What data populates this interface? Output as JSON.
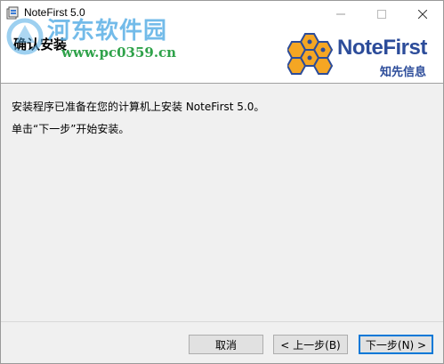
{
  "window": {
    "title": "NoteFirst 5.0",
    "minimize_glyph": "—",
    "maximize_glyph": "☐",
    "close_glyph": "✕"
  },
  "header": {
    "title": "确认安装",
    "logo_text": "NoteFirst",
    "logo_subtext": "知先信息"
  },
  "watermark": {
    "site_name": "河东软件园",
    "url": "www.pc0359.cn"
  },
  "content": {
    "line1": "安装程序已准备在您的计算机上安装 NoteFirst 5.0。",
    "line2": "单击“下一步”开始安装。"
  },
  "buttons": {
    "cancel": "取消",
    "back": "< 上一步(B)",
    "next": "下一步(N) >"
  },
  "colors": {
    "logo_blue": "#2c4c9a",
    "logo_orange": "#f5a623",
    "watermark_blue": "#5bb0e6",
    "watermark_green": "#2fa24a",
    "focus_border": "#0078d7"
  }
}
